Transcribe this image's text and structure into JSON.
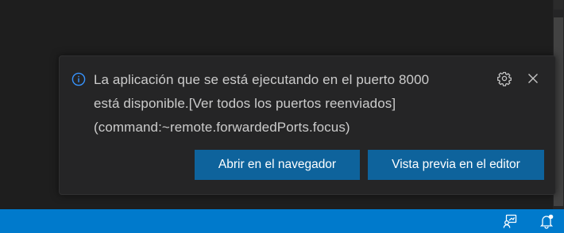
{
  "notification": {
    "icon": "info-icon",
    "message_line1": "La aplicación que se está ejecutando en el puerto 8000",
    "message_line2": "está disponible.[Ver todos los puertos reenviados]",
    "message_line3": "(command:~remote.forwardedPorts.focus)",
    "settings_icon": "gear-icon",
    "close_icon": "close-icon",
    "buttons": {
      "open_browser": "Abrir en el navegador",
      "preview_editor": "Vista previa en el editor"
    }
  },
  "statusbar": {
    "icons": [
      "feedback-icon",
      "notifications-bell-icon"
    ]
  },
  "colors": {
    "editor_bg": "#1e1e1e",
    "toast_bg": "#252526",
    "button_bg": "#0e639c",
    "statusbar_bg": "#007acc",
    "info_icon": "#3794ff"
  }
}
